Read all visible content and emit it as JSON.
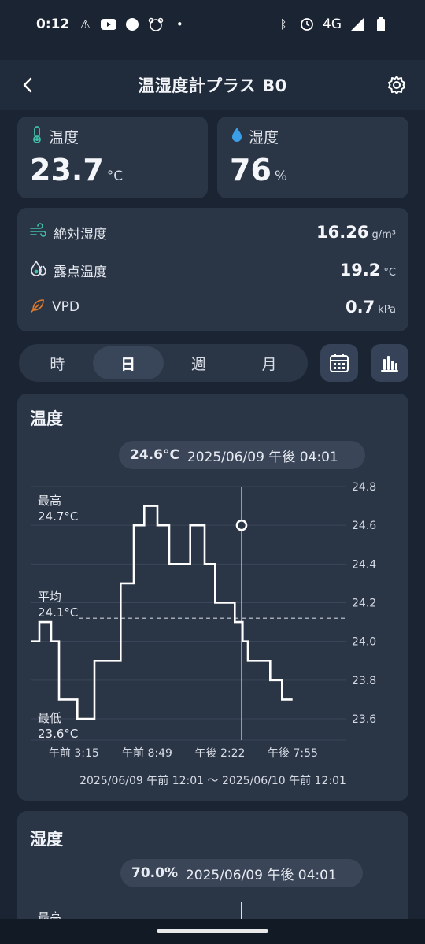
{
  "status_bar": {
    "time": "0:12",
    "network": "4G",
    "left_icons": [
      "warning-icon",
      "youtube-icon",
      "circle-icon",
      "bear-icon",
      "dot-icon"
    ],
    "right_icons": [
      "bluetooth-icon",
      "alarm-icon",
      "signal-icon",
      "battery-icon"
    ]
  },
  "app_bar": {
    "title": "温湿度計プラス B0"
  },
  "metrics": {
    "temperature": {
      "label": "温度",
      "value": "23.7",
      "unit": "°C",
      "icon": "thermometer-icon"
    },
    "humidity": {
      "label": "湿度",
      "value": "76",
      "unit": "%",
      "icon": "droplet-icon"
    }
  },
  "details": [
    {
      "label": "絶対湿度",
      "value": "16.26",
      "unit": "g/m³",
      "icon": "wind-icon"
    },
    {
      "label": "露点温度",
      "value": "19.2",
      "unit": "°C",
      "icon": "dew-icon"
    },
    {
      "label": "VPD",
      "value": "0.7",
      "unit": "kPa",
      "icon": "leaf-icon"
    }
  ],
  "period_tabs": [
    "時",
    "日",
    "週",
    "月"
  ],
  "active_tab": "日",
  "accent_color": "#3fc0a6",
  "temp_chart": {
    "title": "温度",
    "chip_value": "24.6°C",
    "chip_time": "2025/06/09 午後 04:01",
    "max_label": "最高",
    "max_value": "24.7°C",
    "avg_label": "平均",
    "avg_value": "24.1°C",
    "min_label": "最低",
    "min_value": "23.6°C",
    "range": "2025/06/09 午前 12:01 〜 2025/06/10 午前 12:01"
  },
  "chart_data": {
    "type": "line",
    "title": "温度",
    "xlabel": "",
    "ylabel": "",
    "ylim": [
      23.5,
      24.8
    ],
    "x_ticks": [
      "午前 3:15",
      "午前 8:49",
      "午後 2:22",
      "午後 7:55"
    ],
    "y_ticks": [
      24.8,
      24.6,
      24.4,
      24.2,
      24.0,
      23.8,
      23.6
    ],
    "x_ticks_hours": [
      3.23,
      8.82,
      14.37,
      19.92
    ],
    "selected_point": {
      "x_hour": 16.02,
      "y": 24.6
    },
    "average": 24.12,
    "grid": true,
    "series": [
      {
        "x_hour": [
          0.0,
          0.6,
          0.6,
          1.5,
          1.5,
          2.1,
          2.1,
          3.5,
          3.5,
          4.8,
          4.8,
          6.8,
          6.8,
          7.8,
          7.8,
          8.6,
          8.6,
          9.6,
          9.6,
          10.5,
          10.5,
          12.1,
          12.1,
          13.2,
          13.2,
          14.0,
          14.0,
          15.5,
          15.5,
          16.1,
          16.1,
          16.5,
          16.5,
          18.2,
          18.2,
          19.1,
          19.1,
          19.9,
          19.9,
          20.9,
          20.9,
          22.6,
          22.6,
          24.0
        ],
        "y": [
          24.0,
          24.0,
          24.1,
          24.1,
          24.0,
          24.0,
          23.7,
          23.7,
          23.6,
          23.6,
          23.9,
          23.9,
          24.3,
          24.3,
          24.6,
          24.6,
          24.7,
          24.7,
          24.6,
          24.6,
          24.4,
          24.4,
          24.6,
          24.6,
          24.4,
          24.4,
          24.2,
          24.2,
          24.1,
          24.1,
          24.0,
          24.0,
          23.9,
          23.9,
          23.8,
          23.8,
          23.7,
          23.7
        ]
      }
    ]
  },
  "humidity_chart": {
    "title": "湿度",
    "chip_value": "70.0%",
    "chip_time": "2025/06/09 午後 04:01",
    "max_label": "最高"
  }
}
